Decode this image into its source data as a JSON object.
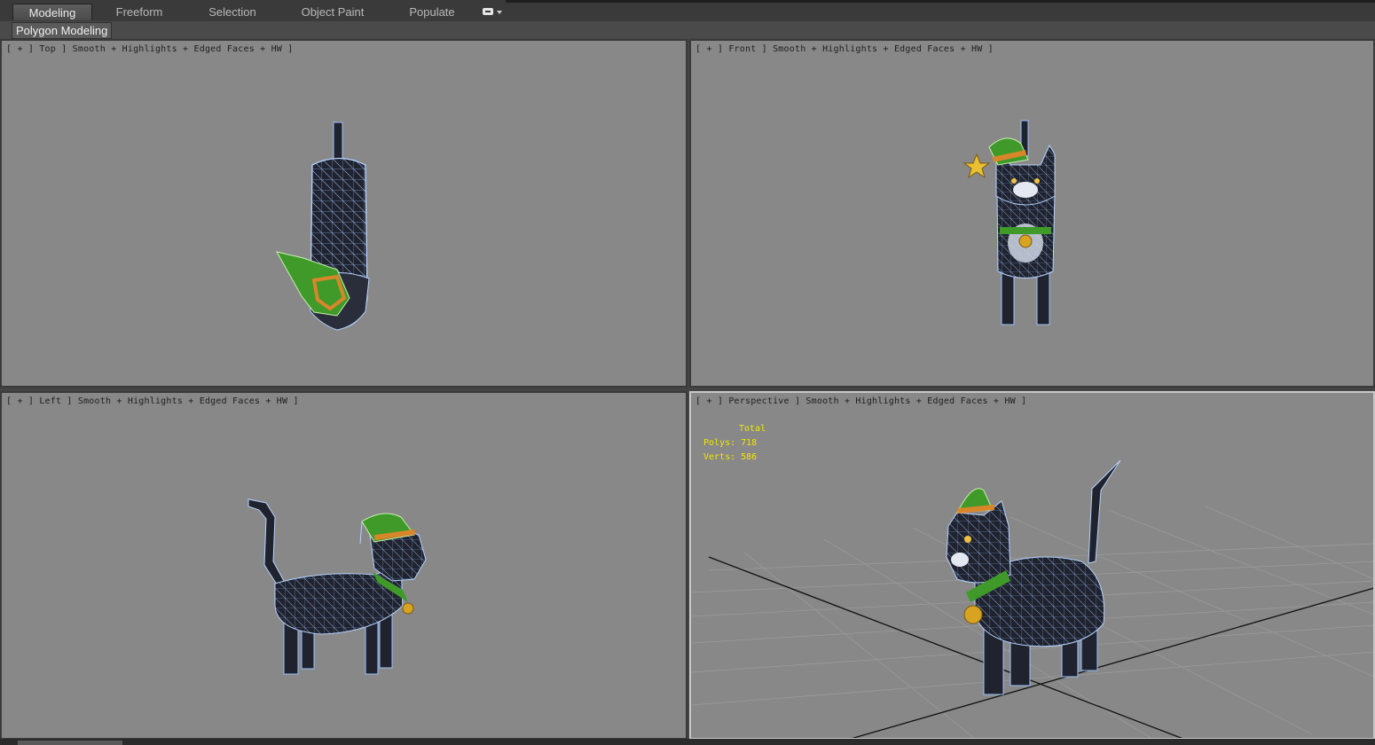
{
  "ribbon": {
    "tabs": [
      {
        "label": "Modeling",
        "active": true
      },
      {
        "label": "Freeform",
        "active": false
      },
      {
        "label": "Selection",
        "active": false
      },
      {
        "label": "Object Paint",
        "active": false
      },
      {
        "label": "Populate",
        "active": false
      }
    ],
    "panel_button": "Polygon Modeling"
  },
  "viewports": {
    "top": {
      "label": "[ + ] Top ] Smooth + Highlights + Edged Faces + HW ]"
    },
    "front": {
      "label": "[ + ] Front ] Smooth + Highlights + Edged Faces + HW ]"
    },
    "left": {
      "label": "[ + ] Left ] Smooth + Highlights + Edged Faces + HW ]"
    },
    "perspective": {
      "label": "[ + ] Perspective ] Smooth + Highlights + Edged Faces + HW ]",
      "stats": {
        "header": "Total",
        "polys": "Polys: 718",
        "verts": "Verts: 586"
      }
    }
  },
  "colors": {
    "viewport_bg": "#888888",
    "mesh_body": "#20232e",
    "wire": "#9fc4ff",
    "hat_green": "#3f9a2a",
    "hat_band": "#d9862a",
    "bell": "#d8a320",
    "stats_text": "#f2e600"
  }
}
